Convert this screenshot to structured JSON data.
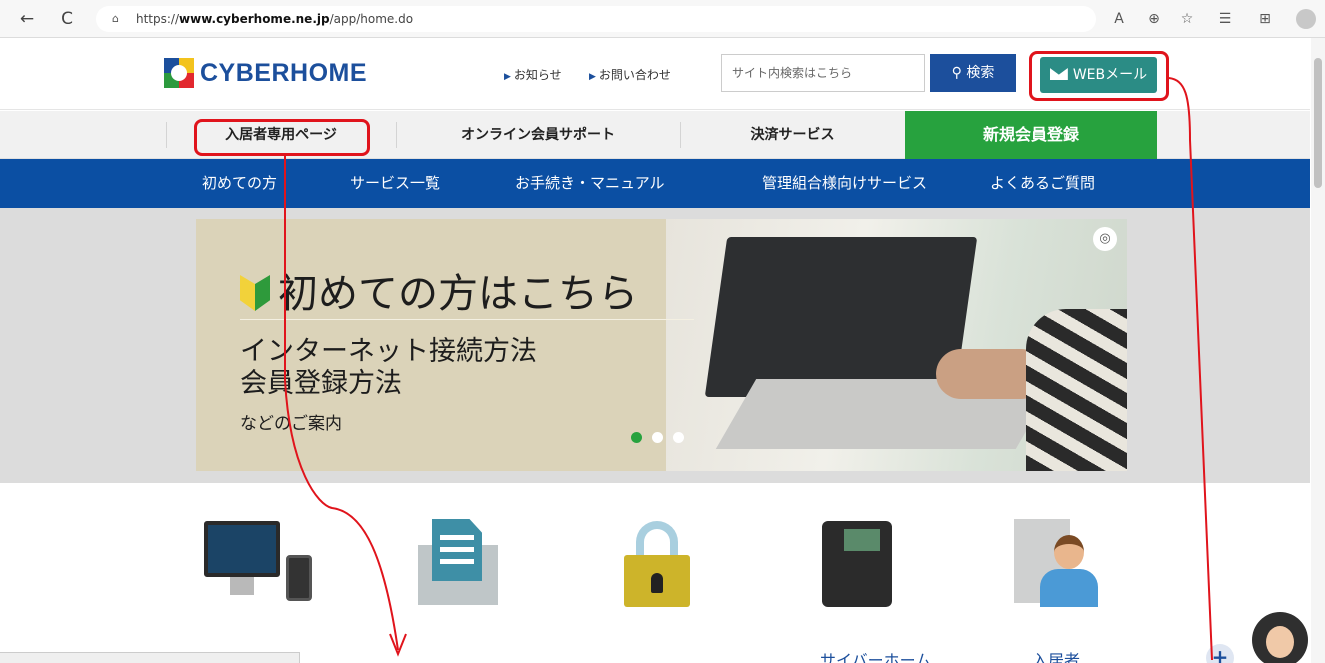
{
  "browser": {
    "url_prefix": "https://",
    "url_domain": "www.cyberhome.ne.jp",
    "url_path": "/app/home.do",
    "back_icon": "←",
    "refresh_icon": "C",
    "lock_icon": "🔒",
    "read_aloud_icon": "A",
    "zoom_icon": "⊕",
    "favorite_icon": "☆",
    "favorites_icon": "☰",
    "collections_icon": "⊕"
  },
  "header": {
    "logo_text": "CYBERHOME",
    "news_link": "お知らせ",
    "contact_link": "お問い合わせ",
    "search_placeholder": "サイト内検索はこちら",
    "search_button": "検索",
    "webmail_button": "WEBメール"
  },
  "subnav": {
    "items": [
      "入居者専用ページ",
      "オンライン会員サポート",
      "決済サービス"
    ],
    "register": "新規会員登録"
  },
  "bluenav": {
    "items": [
      "初めての方",
      "サービス一覧",
      "お手続き・マニュアル",
      "管理組合様向けサービス",
      "よくあるご質問"
    ]
  },
  "banner": {
    "title": "初めての方はこちら",
    "line1": "インターネット接続方法",
    "line2": "会員登録方法",
    "note": "などのご案内",
    "dots": 3,
    "active_dot": 0
  },
  "services": {
    "labels": [
      "インターネット",
      "メール",
      "セキュリティ",
      "サイバーホーム",
      "入居者"
    ]
  },
  "colors": {
    "brand_blue": "#0b4fa3",
    "register_green": "#27a23e",
    "webmail_teal": "#2b8c85",
    "annotation_red": "#e0141c"
  }
}
